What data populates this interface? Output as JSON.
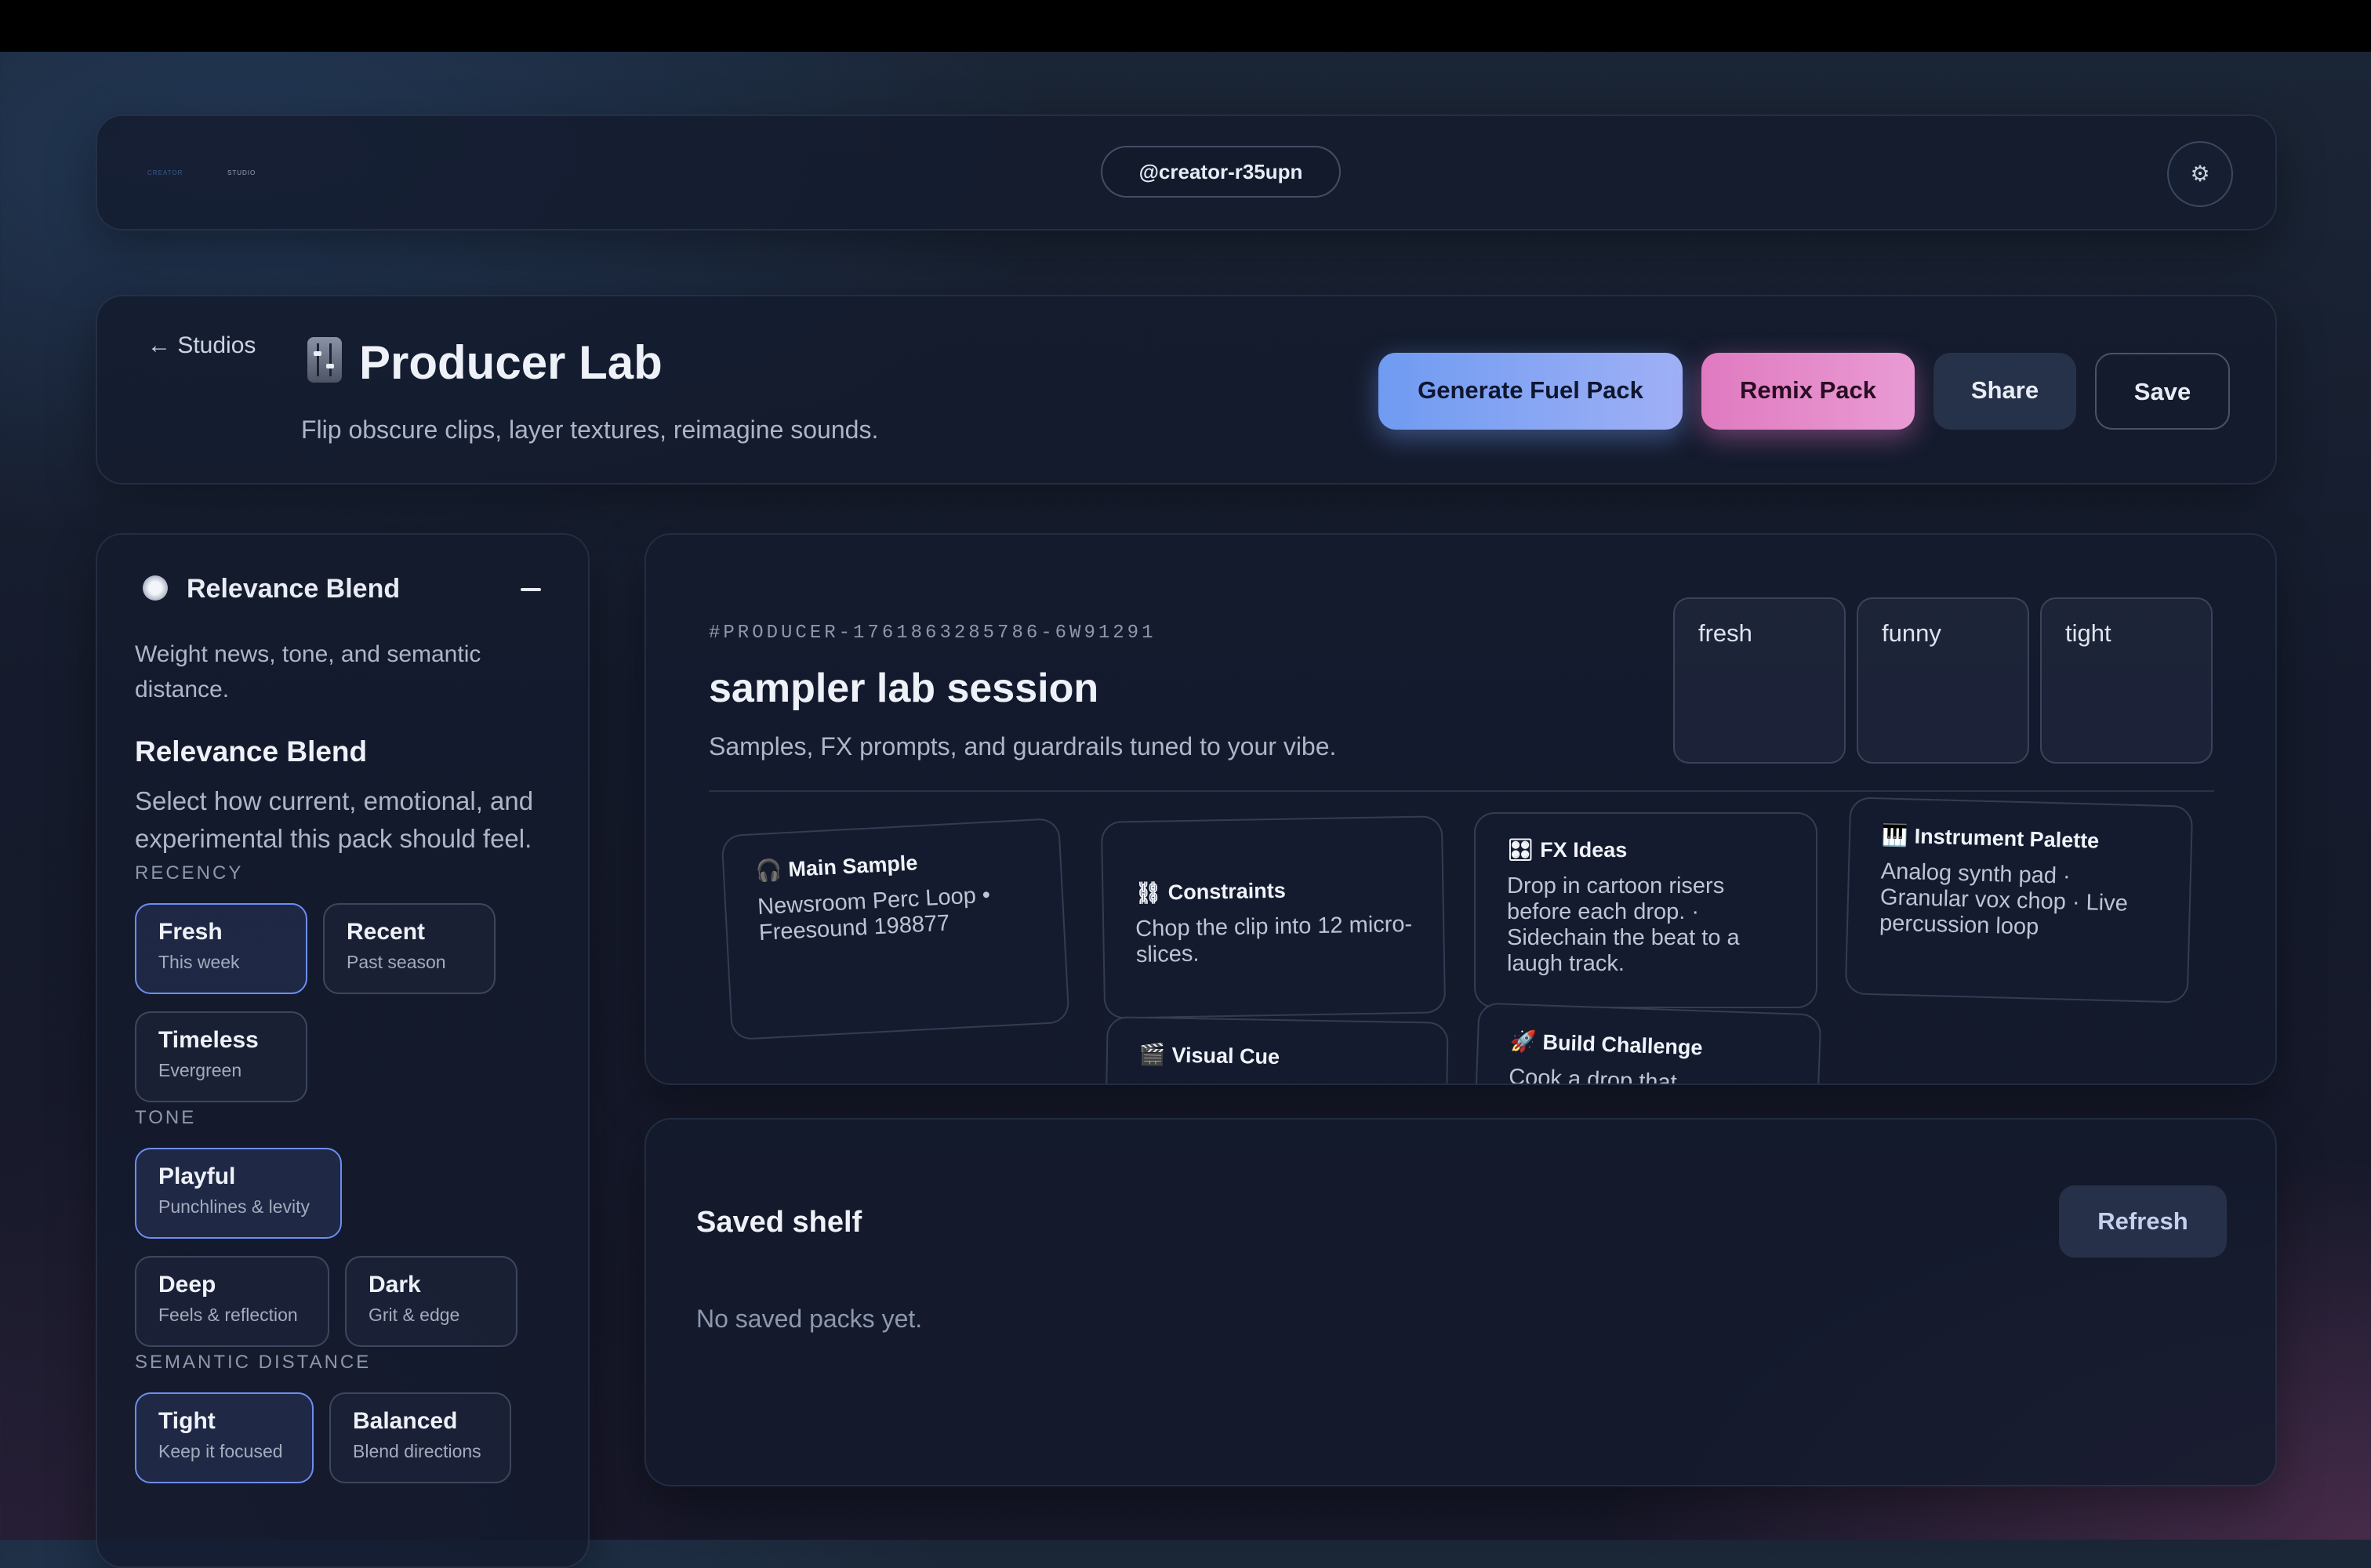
{
  "header": {
    "tiny_left": "CREATOR",
    "tiny_right": "STUDIO",
    "handle": "@creator-r35upn",
    "settings_icon": "gear-icon"
  },
  "studio": {
    "back_label": "← Studios",
    "icon": "mixer-slider-icon",
    "title": "Producer Lab",
    "subtitle": "Flip obscure clips, layer textures, reimagine sounds.",
    "buttons": {
      "generate": "Generate Fuel Pack",
      "remix": "Remix Pack",
      "share": "Share",
      "save": "Save"
    }
  },
  "sidebar": {
    "icon": "compass-icon",
    "title": "Relevance Blend",
    "collapse_icon": "minus-icon",
    "description": "Weight news, tone, and semantic distance.",
    "heading": "Relevance Blend",
    "prompt": "Select how current, emotional, and experimental this pack should feel.",
    "sections": {
      "recency": {
        "label": "RECENCY",
        "options": [
          {
            "title": "Fresh",
            "sub": "This week",
            "selected": true
          },
          {
            "title": "Recent",
            "sub": "Past season",
            "selected": false
          },
          {
            "title": "Timeless",
            "sub": "Evergreen",
            "selected": false
          }
        ]
      },
      "tone": {
        "label": "TONE",
        "options": [
          {
            "title": "Playful",
            "sub": "Punchlines & levity",
            "selected": true
          },
          {
            "title": "Deep",
            "sub": "Feels & reflection",
            "selected": false
          },
          {
            "title": "Dark",
            "sub": "Grit & edge",
            "selected": false
          }
        ]
      },
      "semantic": {
        "label": "SEMANTIC DISTANCE",
        "options": [
          {
            "title": "Tight",
            "sub": "Keep it focused",
            "selected": true
          },
          {
            "title": "Balanced",
            "sub": "Blend directions",
            "selected": false
          }
        ]
      }
    }
  },
  "session": {
    "id": "#PRODUCER-1761863285786-6W91291",
    "name": "sampler lab session",
    "description": "Samples, FX prompts, and guardrails tuned to your vibe.",
    "vibes": [
      "fresh",
      "funny",
      "tight"
    ],
    "cards": [
      {
        "icon": "🎧",
        "title": "Main Sample",
        "body": "Newsroom Perc Loop • Freesound 198877"
      },
      {
        "icon": "⛓",
        "title": "Constraints",
        "body": "Chop the clip into 12 micro-slices."
      },
      {
        "icon": "🎛",
        "title": "FX Ideas",
        "body": "Drop in cartoon risers before each drop. · Sidechain the beat to a laugh track."
      },
      {
        "icon": "🎹",
        "title": "Instrument Palette",
        "body": "Analog synth pad · Granular vox chop · Live percussion loop"
      },
      {
        "icon": "🎬",
        "title": "Visual Cue",
        "body": ""
      },
      {
        "icon": "🚀",
        "title": "Build Challenge",
        "body": "Cook a drop that"
      }
    ]
  },
  "saved": {
    "title": "Saved shelf",
    "refresh": "Refresh",
    "empty": "No saved packs yet."
  },
  "colors": {
    "accent_blue": "#6f9bf1",
    "accent_pink": "#e07ac0",
    "panel": "#141b2d",
    "selected_border": "#6d8ef0"
  }
}
